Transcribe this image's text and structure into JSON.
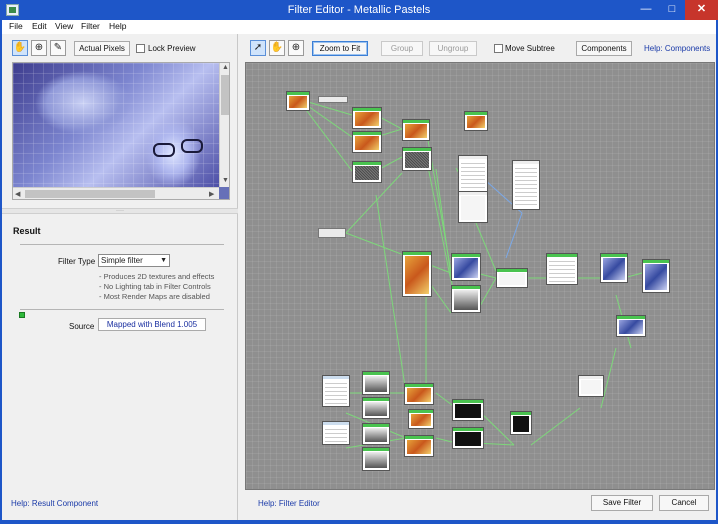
{
  "window": {
    "title": "Filter Editor - Metallic Pastels",
    "close": "✕",
    "minimize": "—",
    "maximize": "□"
  },
  "menu": [
    "File",
    "Edit",
    "View",
    "Filter",
    "Help"
  ],
  "left_toolbar": {
    "actual_pixels": "Actual Pixels",
    "lock_preview": "Lock Preview",
    "lock_preview_checked": false
  },
  "result": {
    "heading": "Result",
    "filter_type_label": "Filter Type",
    "filter_type_value": "Simple filter",
    "notes": [
      "- Produces 2D textures and effects",
      "- No Lighting tab in Filter Controls",
      "- Most Render Maps are disabled"
    ],
    "source_label": "Source",
    "source_value": "Mapped with Blend 1.005"
  },
  "left_help": "Help: Result Component",
  "graph_toolbar": {
    "zoom_to_fit": "Zoom to Fit",
    "group": "Group",
    "ungroup": "Ungroup",
    "move_subtree": "Move Subtree",
    "move_subtree_checked": false,
    "components": "Components",
    "help_components": "Help: Components"
  },
  "bottom": {
    "help": "Help: Filter Editor",
    "save": "Save Filter",
    "cancel": "Cancel"
  },
  "colors": {
    "titlebar": "#1e56c8",
    "graph_bg": "#8f8f8f",
    "node_header": "#49c34f",
    "wire": "#7dd87a",
    "wire_blue": "#7aa8e8",
    "close": "#c7352b"
  }
}
